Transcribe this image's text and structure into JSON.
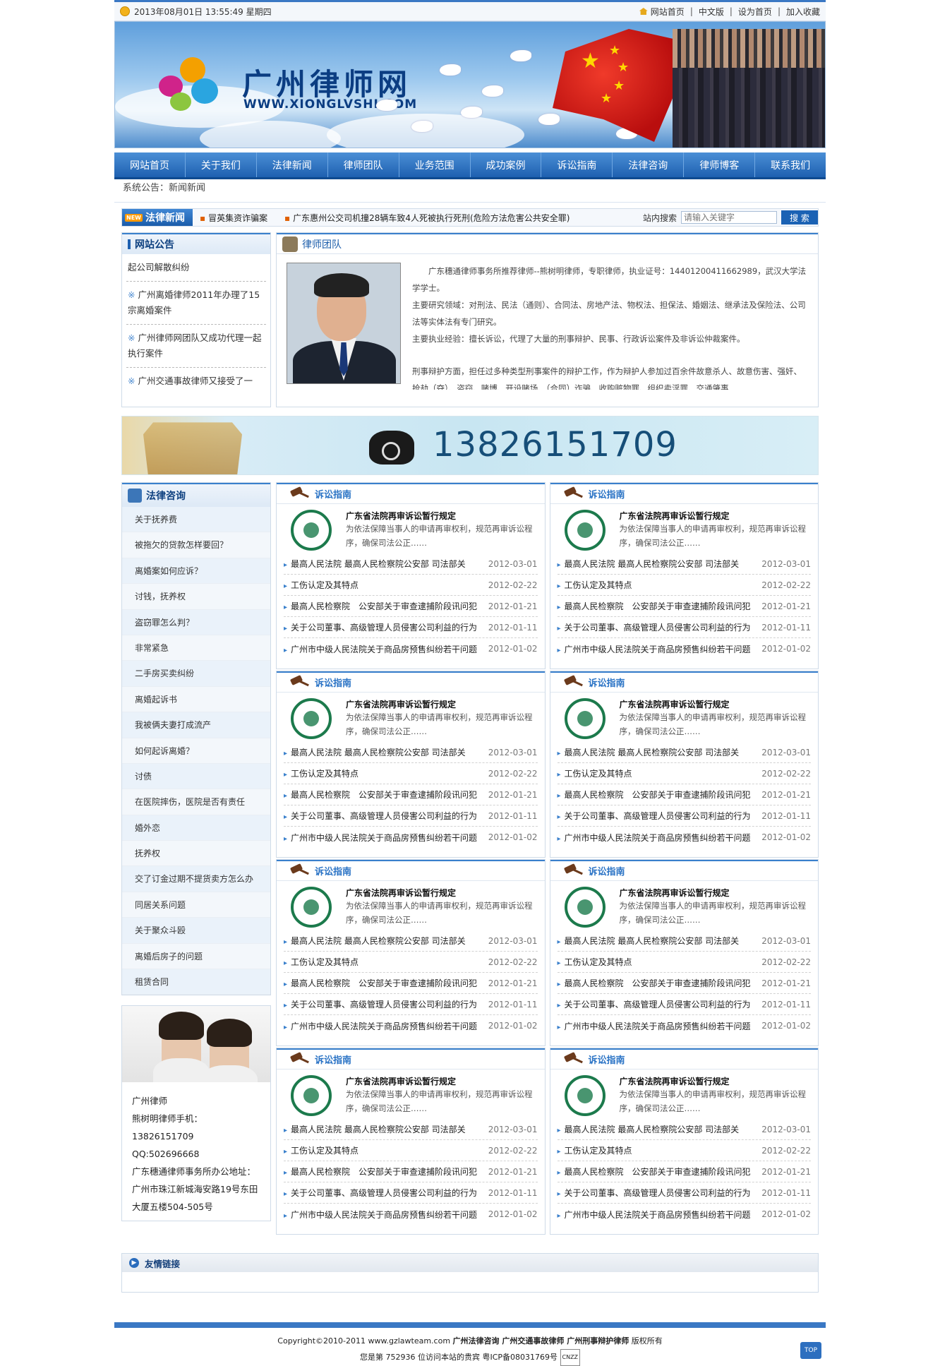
{
  "topbar": {
    "datetime": "2013年08月01日 13:55:49 星期四",
    "links": [
      "网站首页",
      "中文版",
      "设为首页",
      "加入收藏"
    ]
  },
  "banner": {
    "site_name": "广州律师网",
    "site_url": "WWW.XIONGLVSHI.COM"
  },
  "nav": [
    "网站首页",
    "关于我们",
    "法律新闻",
    "律师团队",
    "业务范围",
    "成功案例",
    "诉讼指南",
    "法律咨询",
    "律师博客",
    "联系我们"
  ],
  "notice": "系统公告：新闻新闻",
  "newsbar": {
    "tag": "法律新闻",
    "new_badge": "NEW",
    "items": [
      "冒英集资诈骗案",
      "广东惠州公交司机撞28辆车致4人死被执行死刑(危险方法危害公共安全罪)"
    ],
    "search_label": "站内搜索",
    "search_placeholder": "请输入关键字",
    "search_button": "搜 索"
  },
  "notices_box": {
    "title": "网站公告",
    "items": [
      "起公司解散纠纷",
      "广州离婚律师2011年办理了15宗离婚案件",
      "广州律师网团队又成功代理一起执行案件",
      "广州交通事故律师又接受了一"
    ]
  },
  "team": {
    "title": "律师团队",
    "bio": [
      "广东穗通律师事务所推荐律师--熊树明律师，专职律师，执业证号：14401200411662989，武汉大学法学学士。",
      "主要研究领域：对刑法、民法（通则）、合同法、房地产法、物权法、担保法、婚姻法、继承法及保险法、公司法等实体法有专门研究。",
      "主要执业经验：擅长诉讼，代理了大量的刑事辩护、民事、行政诉讼案件及非诉讼仲裁案件。",
      "刑事辩护方面，担任过多种类型刑事案件的辩护工作，作为辩护人参加过百余件故意杀人、故意伤害、强奸、抢劫（夺）、盗窃、赌博、开设赌场、（合同）诈骗、收购赃物罪、组织卖淫罪、交通肇事"
    ]
  },
  "phone_banner": "13826151709",
  "consult": {
    "title": "法律咨询",
    "items": [
      "关于抚养费",
      "被拖欠的贷款怎样要回？",
      "离婚案如何应诉？",
      "讨钱，抚养权",
      "盗窃罪怎么判？",
      "非常紧急",
      "二手房买卖纠纷",
      "离婚起诉书",
      "我被俩夫妻打成流产",
      "如何起诉离婚？",
      "讨债",
      "在医院摔伤，医院是否有责任",
      "婚外恋",
      "抚养权",
      "交了订金过期不提货卖方怎么办",
      "同居关系问题",
      "关于聚众斗殴",
      "离婚后房子的问题",
      "租赁合同"
    ]
  },
  "contact": {
    "lines": [
      "广州律师",
      "熊树明律师手机：",
      "13826151709",
      "QQ:502696668",
      "广东穗通律师事务所办公地址：",
      "广州市珠江新城海安路19号东田大厦五楼504-505号"
    ]
  },
  "guide_card": {
    "title": "诉讼指南",
    "feature_title": "广东省法院再审诉讼暂行规定",
    "feature_summary": "为依法保障当事人的申请再审权利，规范再审诉讼程序，确保司法公正……",
    "items": [
      {
        "text": "最高人民法院 最高人民检察院公安部 司法部关",
        "date": "2012-03-01"
      },
      {
        "text": "工伤认定及其特点",
        "date": "2012-02-22"
      },
      {
        "text": "最高人民检察院　公安部关于审查逮捕阶段讯问犯",
        "date": "2012-01-21"
      },
      {
        "text": "关于公司董事、高级管理人员侵害公司利益的行为",
        "date": "2012-01-11"
      },
      {
        "text": "广州市中级人民法院关于商品房预售纠纷若干问题",
        "date": "2012-01-02"
      }
    ]
  },
  "friend_links": {
    "title": "友情链接"
  },
  "footer": {
    "copyright": "Copyright©2010-2011 www.gzlawteam.com",
    "keywords": "广州法律咨询 广州交通事故律师 广州刑事辩护律师",
    "rights": "版权所有",
    "visits_prefix": "您是第",
    "visits_count": "752936",
    "visits_suffix": "位访问本站的贵宾",
    "icp": "粤ICP备08031769号",
    "cnzz": "CNZZ",
    "top": "TOP"
  },
  "colors": {
    "brand": "#1e60b0",
    "accent": "#3a80cc",
    "nav_top": "#4b8fd6"
  }
}
